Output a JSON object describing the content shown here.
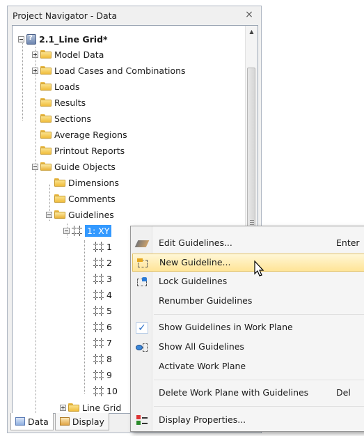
{
  "panel": {
    "title": "Project Navigator - Data",
    "close_label": "×"
  },
  "tree": {
    "root": "2.1_Line Grid*",
    "items": [
      "Model Data",
      "Load Cases and Combinations",
      "Loads",
      "Results",
      "Sections",
      "Average Regions",
      "Printout Reports",
      "Guide Objects",
      "Dimensions",
      "Comments",
      "Guidelines",
      "1: XY",
      "1",
      "2",
      "3",
      "4",
      "5",
      "6",
      "7",
      "8",
      "9",
      "10",
      "Line Grid"
    ]
  },
  "tabs": [
    "Data",
    "Display"
  ],
  "context_menu": {
    "items": [
      {
        "label": "Edit Guidelines...",
        "shortcut": "Enter",
        "icon": "edit-icon"
      },
      {
        "label": "New Guideline...",
        "shortcut": "",
        "icon": "new-guideline-icon"
      },
      {
        "label": "Lock Guidelines",
        "shortcut": "",
        "icon": "lock-icon"
      },
      {
        "label": "Renumber Guidelines",
        "shortcut": "",
        "icon": ""
      },
      {
        "label": "Show Guidelines in Work Plane",
        "shortcut": "",
        "icon": "checkmark-icon"
      },
      {
        "label": "Show All Guidelines",
        "shortcut": "",
        "icon": "eye-icon"
      },
      {
        "label": "Activate Work Plane",
        "shortcut": "",
        "icon": ""
      },
      {
        "label": "Delete Work Plane with Guidelines",
        "shortcut": "Del",
        "icon": ""
      },
      {
        "label": "Display Properties...",
        "shortcut": "",
        "icon": "properties-icon"
      }
    ],
    "check_mark": "✓",
    "highlighted_index": 1
  },
  "colors": {
    "selection": "#3399ff",
    "menu_highlight": "#ffe497",
    "folder": "#f0bd3d"
  }
}
